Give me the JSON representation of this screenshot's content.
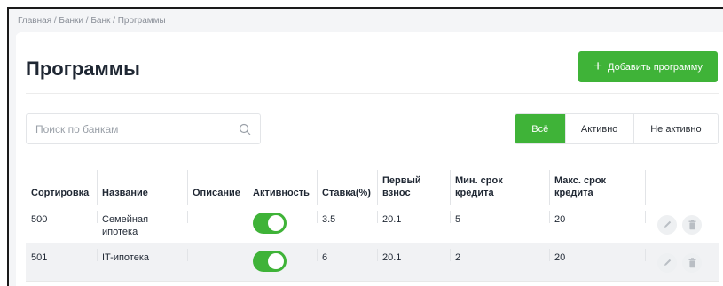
{
  "breadcrumb": "Главная  /  Банки  /  Банк  / Программы",
  "page_title": "Программы",
  "add_button_label": "Добавить программу",
  "search": {
    "placeholder": "Поиск по банкам",
    "value": ""
  },
  "filters": [
    {
      "label": "Всё",
      "active": true
    },
    {
      "label": "Активно",
      "active": false
    },
    {
      "label": "Не активно",
      "active": false
    }
  ],
  "columns": [
    "Сортировка",
    "Название",
    "Описание",
    "Активность",
    "Ставка(%)",
    "Первый взнос",
    "Мин. срок кредита",
    "Макс. срок кредита",
    ""
  ],
  "rows": [
    {
      "sort": "500",
      "name": "Семейная ипотека",
      "description": "",
      "active": true,
      "rate": "3.5",
      "down_payment": "20.1",
      "min_term": "5",
      "max_term": "20"
    },
    {
      "sort": "501",
      "name": "IT-ипотека",
      "description": "",
      "active": true,
      "rate": "6",
      "down_payment": "20.1",
      "min_term": "2",
      "max_term": "20"
    }
  ],
  "colors": {
    "accent": "#3fb338",
    "text": "#1f2733",
    "muted": "#8a8f98"
  },
  "icons": {
    "search": "search-icon",
    "edit": "pencil-icon",
    "delete": "trash-icon",
    "add": "plus-icon"
  }
}
